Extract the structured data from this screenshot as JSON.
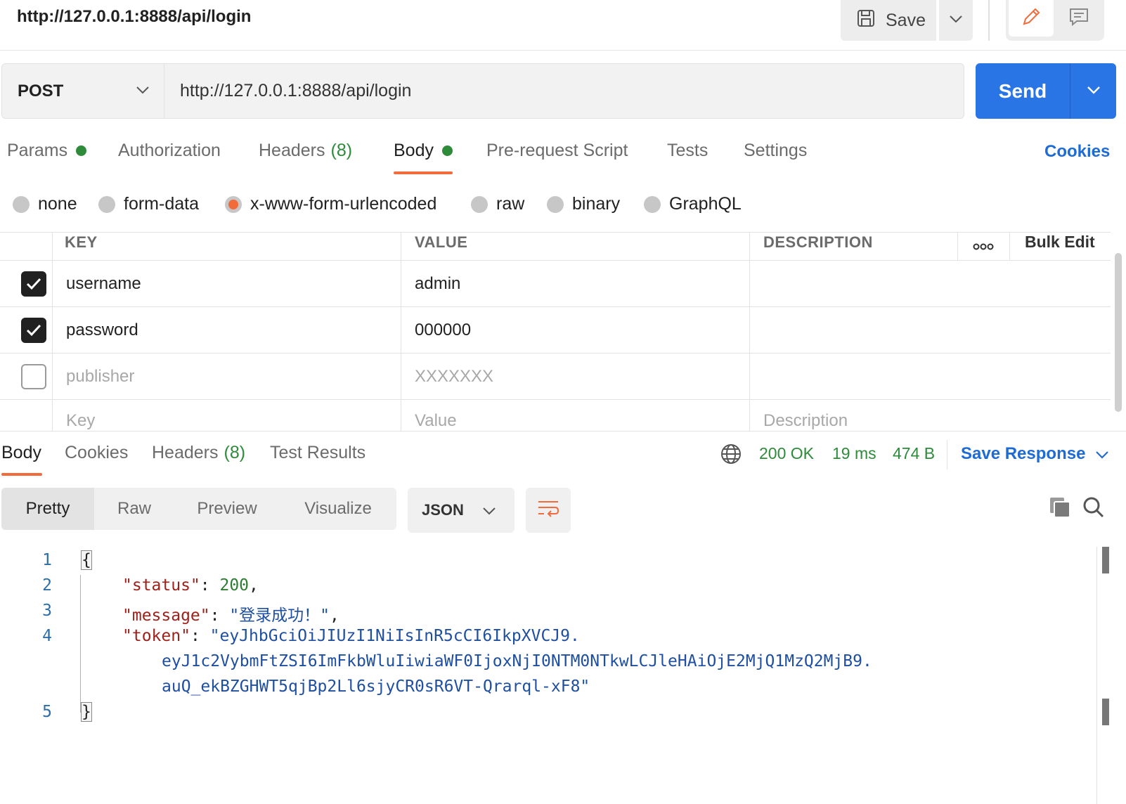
{
  "tab": {
    "title": "http://127.0.0.1:8888/api/login"
  },
  "toolbar": {
    "save_label": "Save"
  },
  "request": {
    "method": "POST",
    "url": "http://127.0.0.1:8888/api/login",
    "send_label": "Send"
  },
  "request_tabs": {
    "params": "Params",
    "authorization": "Authorization",
    "headers": "Headers",
    "headers_count": "(8)",
    "body": "Body",
    "pre_request": "Pre-request Script",
    "tests": "Tests",
    "settings": "Settings",
    "cookies": "Cookies",
    "active": "Body"
  },
  "body_types": {
    "none": "none",
    "form_data": "form-data",
    "urlencoded": "x-www-form-urlencoded",
    "raw": "raw",
    "binary": "binary",
    "graphql": "GraphQL",
    "selected": "x-www-form-urlencoded"
  },
  "params_table": {
    "headers": {
      "key": "KEY",
      "value": "VALUE",
      "description": "DESCRIPTION",
      "bulk_edit": "Bulk Edit"
    },
    "rows": [
      {
        "checked": true,
        "key": "username",
        "value": "admin",
        "description": ""
      },
      {
        "checked": true,
        "key": "password",
        "value": "000000",
        "description": ""
      },
      {
        "checked": false,
        "key": "publisher",
        "value": "XXXXXXX",
        "description": ""
      }
    ],
    "placeholders": {
      "key": "Key",
      "value": "Value",
      "description": "Description"
    }
  },
  "response": {
    "tabs": {
      "body": "Body",
      "cookies": "Cookies",
      "headers": "Headers",
      "headers_count": "(8)",
      "test_results": "Test Results",
      "active": "Body"
    },
    "status": "200 OK",
    "time": "19 ms",
    "size": "474 B",
    "save_response": "Save Response",
    "views": {
      "pretty": "Pretty",
      "raw": "Raw",
      "preview": "Preview",
      "visualize": "Visualize",
      "active": "Pretty"
    },
    "format": "JSON",
    "code": {
      "line_numbers": [
        "1",
        "2",
        "3",
        "4",
        "5"
      ],
      "open_brace": "{",
      "close_brace": "}",
      "status_key": "\"status\"",
      "status_value": "200",
      "message_key": "\"message\"",
      "message_value": "\"登录成功！\"",
      "token_key": "\"token\"",
      "token_line1": "\"eyJhbGciOiJIUzI1NiIsInR5cCI6IkpXVCJ9.",
      "token_line2": "eyJ1c2VybmFtZSI6ImFkbWluIiwiaWF0IjoxNjI0NTM0NTkwLCJleHAiOjE2MjQ1MzQ2MjB9.",
      "token_line3": "auQ_ekBZGHWT5qjBp2Ll6sjyCR0sR6VT-Qrarql-xF8\""
    }
  },
  "colors": {
    "accent_orange": "#f26b3a",
    "send_blue": "#2a75e6",
    "link_blue": "#1f6bd6",
    "status_green": "#2e8b3a"
  },
  "icons": {
    "save": "save-icon",
    "edit": "pencil-icon",
    "comment": "comment-icon",
    "globe": "globe-icon",
    "wrap": "wrap-lines-icon",
    "copy": "copy-icon",
    "search": "search-icon"
  }
}
